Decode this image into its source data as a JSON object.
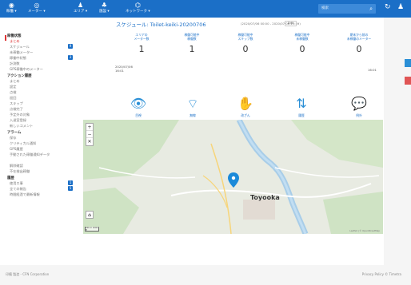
{
  "topnav": [
    {
      "icon": "◉",
      "label": "稼働 ▾"
    },
    {
      "icon": "◎",
      "label": "メーター ▾"
    },
    {
      "icon": "♟",
      "label": "エリア ▾"
    },
    {
      "icon": "♣",
      "label": "施設 ▾"
    },
    {
      "icon": "⌬",
      "label": "ネットワーク ▾"
    }
  ],
  "search_placeholder": "検索",
  "sidebar": {
    "sections": [
      {
        "label": "稼働状態"
      },
      {
        "label": "アクション履歴"
      },
      {
        "label": "アラーム"
      },
      {
        "label": "履歴"
      }
    ],
    "items": [
      "まとめ",
      "スケジュール",
      "未稼働メーター",
      "稼働中状態",
      "計測数",
      "GPS稼働中のメーター",
      "まとめ",
      "設定",
      "点検",
      "巡回",
      "スキップ",
      "点検完了",
      "予定外の対象",
      "入退室登録",
      "新しいコメント",
      "保存",
      "クリティカル通知",
      "GPS履歴",
      "手動された稼働通知データ",
      "解除確認",
      "不在検出稼働",
      "使用エ事",
      "全ての報告",
      "時間経過で最新情報"
    ],
    "badges": [
      "9",
      "3",
      "1",
      "5"
    ]
  },
  "main": {
    "title": "スケジュール: Toilet-keiki-20200706",
    "daterange": "(2020/07/06 00:00 - 2020/07/06 23:59)",
    "edit": "Edit",
    "stats": [
      {
        "label": "エリアの\nメーター数",
        "value": "1"
      },
      {
        "label": "稼働可能中\n稼働数",
        "value": "1"
      },
      {
        "label": "稼働可能中\nスキップ数",
        "value": "0"
      },
      {
        "label": "稼働可能中\n未稼働数",
        "value": "0"
      },
      {
        "label": "期末から前の\n未稼働のメーター",
        "value": "0"
      }
    ],
    "timeline_start": "2020/07/06\n16:01",
    "timeline_end": "16:01",
    "icons": [
      {
        "icon": "visible-icon",
        "glyph": "👁",
        "name": "目視",
        "count": "0"
      },
      {
        "icon": "wireless-icon",
        "glyph": "⌔",
        "name": "無線",
        "count": "1"
      },
      {
        "icon": "skip-icon",
        "glyph": "✋",
        "name": "改ざん",
        "count": "0"
      },
      {
        "icon": "transfer-icon",
        "glyph": "⇅",
        "name": "履歴",
        "count": "1"
      },
      {
        "icon": "comment-icon",
        "glyph": "💬",
        "name": "例外",
        "count": "0"
      }
    ]
  },
  "map": {
    "label": "Toyooka",
    "attribution": "Leaflet | © OpenStreetMap",
    "scale": "500 m\n1000 ft"
  },
  "footer": {
    "left": "印備 製造 - CFN Corporation",
    "right": "Privacy Policy © Timetra"
  },
  "colors": {
    "primary": "#1b6fc7",
    "accent": "#2a8fd6",
    "alert": "#d33"
  }
}
